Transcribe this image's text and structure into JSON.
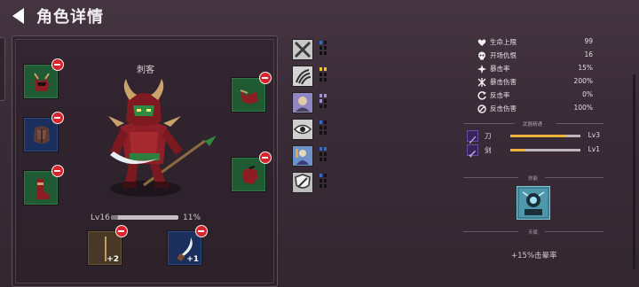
{
  "header": {
    "title": "角色详情"
  },
  "character": {
    "class_name": "刺客",
    "level": "Lv16",
    "exp_percent": "11%",
    "exp_fraction": 0.11
  },
  "equipment": {
    "remove_icon": "minus-circle-icon",
    "left_slots": [
      {
        "name": "helmet",
        "rarity": "green"
      },
      {
        "name": "armor",
        "rarity": "blue"
      },
      {
        "name": "boots",
        "rarity": "green"
      }
    ],
    "right_slots": [
      {
        "name": "shoulder",
        "rarity": "green"
      },
      {
        "name": "gloves",
        "rarity": "green"
      }
    ],
    "bottom_slots": [
      {
        "name": "stick",
        "rarity": "brown",
        "count": "+2"
      },
      {
        "name": "knife",
        "rarity": "blue",
        "count": "+1"
      }
    ]
  },
  "skills": [
    {
      "icon": "crossed-swords-icon",
      "pips": [
        "#2d6fd0",
        "#111",
        "#111",
        "#111",
        "#111",
        "#111"
      ]
    },
    {
      "icon": "claw-icon",
      "pips": [
        "#f1c232",
        "#f1c232",
        "#111",
        "#111",
        "#111",
        "#111"
      ]
    },
    {
      "icon": "rogue-portrait-icon",
      "pips": [
        "#9c92d8",
        "#9c92d8",
        "#9c92d8",
        "#111",
        "#111",
        "#111"
      ]
    },
    {
      "icon": "eye-icon",
      "pips": [
        "#2d6fd0",
        "#111",
        "#111",
        "#111",
        "#111",
        "#111"
      ]
    },
    {
      "icon": "summon-portrait-icon",
      "pips": [
        "#2d6fd0",
        "#2d6fd0",
        "#111",
        "#111",
        "#111",
        "#111"
      ]
    },
    {
      "icon": "shield-slash-icon",
      "pips": [
        "#2d6fd0",
        "#111",
        "#111",
        "#111",
        "#111",
        "#111"
      ]
    }
  ],
  "stats": [
    {
      "icon": "heart-icon",
      "label": "生命上限",
      "value": "99"
    },
    {
      "icon": "skull-icon",
      "label": "开场仇恨",
      "value": "16"
    },
    {
      "icon": "crit-star-icon",
      "label": "暴击率",
      "value": "15%"
    },
    {
      "icon": "crit-burst-icon",
      "label": "暴击伤害",
      "value": "200%"
    },
    {
      "icon": "counter-icon",
      "label": "反击率",
      "value": "0%"
    },
    {
      "icon": "counter-damage-icon",
      "label": "反击伤害",
      "value": "100%"
    }
  ],
  "weapon_mastery": {
    "title": "武器精通",
    "items": [
      {
        "icon": "blade-icon",
        "name": "刀",
        "level": "Lv3",
        "fraction": 0.78
      },
      {
        "icon": "sword-icon",
        "name": "剑",
        "level": "Lv1",
        "fraction": 0.22
      }
    ]
  },
  "talent": {
    "title": "技能",
    "footer_title": "天赋",
    "icon": "robot-portrait-icon",
    "bonus_text": "+15%击晕率"
  },
  "colors": {
    "accent_orange": "#f0b33a",
    "remove_red": "#d7252c",
    "card_teal": "#3d7f91"
  }
}
